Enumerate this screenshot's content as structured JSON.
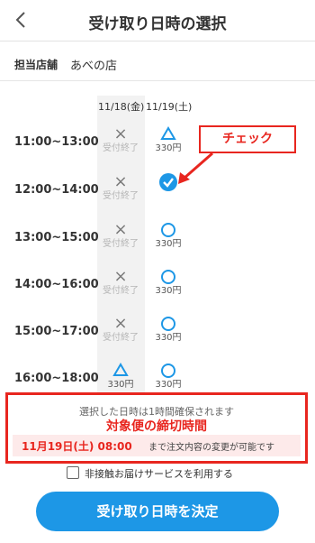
{
  "header": {
    "title": "受け取り日時の選択",
    "back_icon": "chevron-left-icon"
  },
  "store": {
    "label": "担当店舗",
    "value": "あべの店"
  },
  "dates": [
    "11/18(金)",
    "11/19(土)"
  ],
  "slots": [
    {
      "time": "11:00~13:00",
      "cells": [
        {
          "mark": "×",
          "text": "受付終了"
        },
        {
          "mark": "△",
          "text": "330円"
        }
      ]
    },
    {
      "time": "12:00~14:00",
      "cells": [
        {
          "mark": "×",
          "text": "受付終了"
        },
        {
          "mark": "selected-check",
          "text": ""
        }
      ]
    },
    {
      "time": "13:00~15:00",
      "cells": [
        {
          "mark": "×",
          "text": "受付終了"
        },
        {
          "mark": "○",
          "text": "330円"
        }
      ]
    },
    {
      "time": "14:00~16:00",
      "cells": [
        {
          "mark": "×",
          "text": "受付終了"
        },
        {
          "mark": "○",
          "text": "330円"
        }
      ]
    },
    {
      "time": "15:00~17:00",
      "cells": [
        {
          "mark": "×",
          "text": "受付終了"
        },
        {
          "mark": "○",
          "text": "330円"
        }
      ]
    },
    {
      "time": "16:00~18:00",
      "cells": [
        {
          "mark": "△",
          "text": "330円"
        },
        {
          "mark": "○",
          "text": "330円"
        }
      ]
    }
  ],
  "callout": {
    "text": "チェック"
  },
  "notice": {
    "line1": "選択した日時は1時間確保されます",
    "emphasis": "対象便の締切時間",
    "deadline": "11月19日(土) 08:00",
    "tail": "まで注文内容の変更が可能です"
  },
  "option": {
    "label": "非接触お届けサービスを利用する",
    "checked": false
  },
  "submit": {
    "label": "受け取り日時を決定"
  },
  "colors": {
    "accent": "#1d97e6",
    "highlight": "#e8261f"
  }
}
